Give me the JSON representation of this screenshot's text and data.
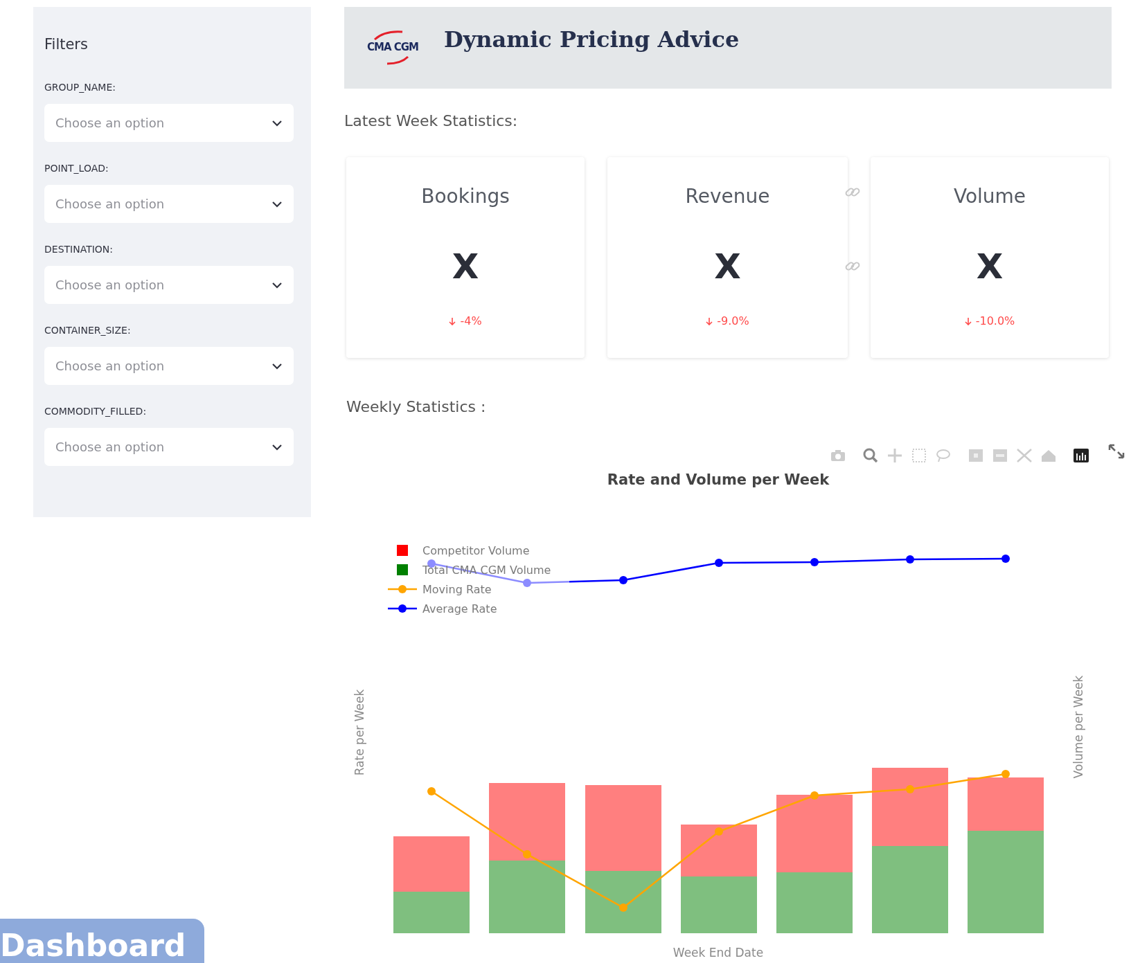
{
  "sidebar": {
    "title": "Filters",
    "filters": [
      {
        "label": "GROUP_NAME:",
        "placeholder": "Choose an option"
      },
      {
        "label": "POINT_LOAD:",
        "placeholder": "Choose an option"
      },
      {
        "label": "DESTINATION:",
        "placeholder": "Choose an option"
      },
      {
        "label": "CONTAINER_SIZE:",
        "placeholder": "Choose an option"
      },
      {
        "label": "COMMODITY_FILLED:",
        "placeholder": "Choose an option"
      }
    ]
  },
  "header": {
    "logo_text": "CMA CGM",
    "title": "Dynamic Pricing Advice"
  },
  "latest_heading": "Latest Week Statistics:",
  "metrics": [
    {
      "label": "Bookings",
      "value": "X",
      "delta": "-4%",
      "decrease": true
    },
    {
      "label": "Revenue",
      "value": "X",
      "delta": "-9.0%",
      "decrease": true
    },
    {
      "label": "Volume",
      "value": "X",
      "delta": "-10.0%",
      "decrease": true
    }
  ],
  "weekly_heading": "Weekly Statistics :",
  "chart": {
    "title": "Rate and Volume per Week",
    "y_title": "Rate per Week",
    "y2_title": "Volume per Week",
    "x_title": "Week End Date",
    "legend": [
      {
        "name": "Competitor Volume",
        "kind": "bar",
        "color": "#ff0000"
      },
      {
        "name": "Total CMA CGM Volume",
        "kind": "bar",
        "color": "#008000"
      },
      {
        "name": "Moving Rate",
        "kind": "line",
        "color": "#ffa500"
      },
      {
        "name": "Average Rate",
        "kind": "line",
        "color": "#0000ff"
      }
    ]
  },
  "nav_button": "Dashboard"
}
